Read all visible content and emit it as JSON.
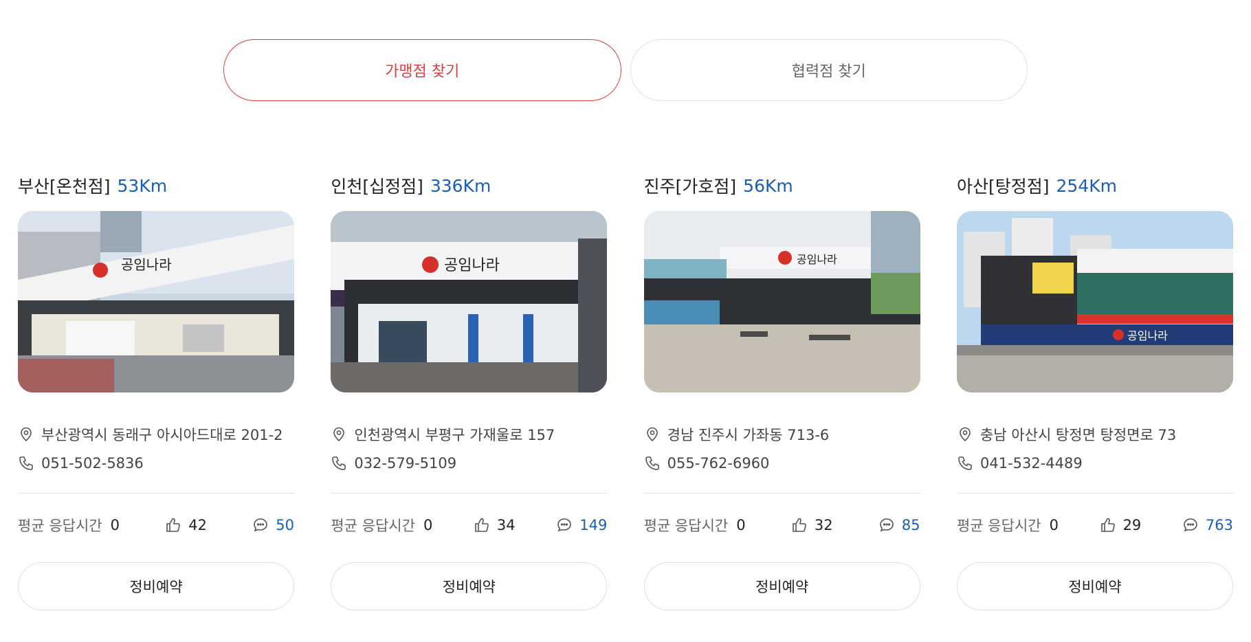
{
  "tabs": [
    {
      "label": "가맹점 찾기",
      "active": true
    },
    {
      "label": "협력점 찾기",
      "active": false
    }
  ],
  "colors": {
    "accent": "#e23c3c",
    "distance": "#1a5fb4"
  },
  "stores": [
    {
      "title": "부산[온천점]",
      "distance": "53Km",
      "address": "부산광역시 동래구 아시아드대로 201-2",
      "phone": "051-502-5836",
      "response_label": "평균 응답시간",
      "response_value": "0",
      "likes": "42",
      "comments": "50",
      "reserve_label": "정비예약"
    },
    {
      "title": "인천[십정점]",
      "distance": "336Km",
      "address": "인천광역시 부평구 가재울로 157",
      "phone": "032-579-5109",
      "response_label": "평균 응답시간",
      "response_value": "0",
      "likes": "34",
      "comments": "149",
      "reserve_label": "정비예약"
    },
    {
      "title": "진주[가호점]",
      "distance": "56Km",
      "address": "경남 진주시 가좌동 713-6",
      "phone": "055-762-6960",
      "response_label": "평균 응답시간",
      "response_value": "0",
      "likes": "32",
      "comments": "85",
      "reserve_label": "정비예약"
    },
    {
      "title": "아산[탕정점]",
      "distance": "254Km",
      "address": "충남 아산시 탕정면 탕정면로 73",
      "phone": "041-532-4489",
      "response_label": "평균 응답시간",
      "response_value": "0",
      "likes": "29",
      "comments": "763",
      "reserve_label": "정비예약"
    }
  ],
  "photo_signage": [
    "공임나라",
    "공임나라",
    "공임나라",
    "공임나라"
  ],
  "icons": {
    "address": "location-pin-icon",
    "phone": "phone-icon",
    "like": "thumbs-up-icon",
    "comment": "chat-bubble-icon"
  }
}
